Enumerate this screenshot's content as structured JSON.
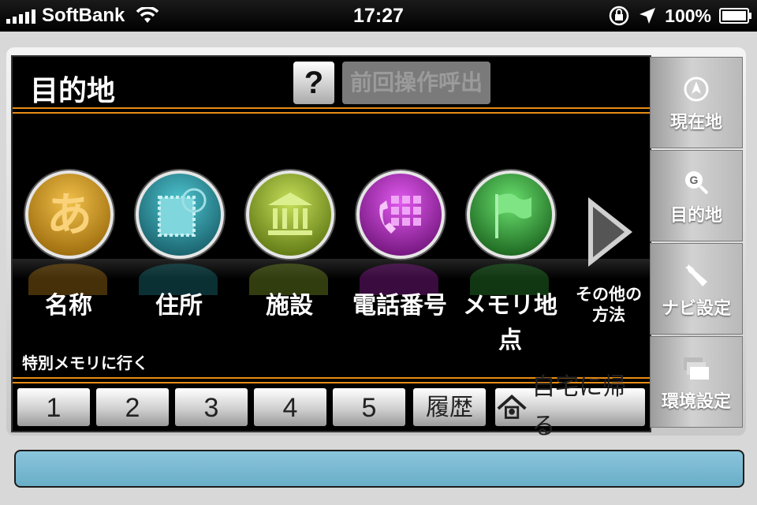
{
  "status_bar": {
    "carrier": "SoftBank",
    "time": "17:27",
    "battery": "100%"
  },
  "header": {
    "title": "目的地",
    "help_label": "?",
    "recall_label": "前回操作呼出"
  },
  "destinations": [
    {
      "label": "名称",
      "icon": "hiragana-a-icon",
      "glyph": "あ",
      "color": "#c98a1a"
    },
    {
      "label": "住所",
      "icon": "postal-stamp-icon",
      "glyph": "",
      "color": "#1e8a96"
    },
    {
      "label": "施設",
      "icon": "building-icon",
      "glyph": "",
      "color": "#8fae2a"
    },
    {
      "label": "電話番号",
      "icon": "phone-keypad-icon",
      "glyph": "",
      "color": "#a71fb3"
    },
    {
      "label": "メモリ地点",
      "icon": "flag-icon",
      "glyph": "",
      "color": "#2e9b33"
    }
  ],
  "other_methods": {
    "line1": "その他の",
    "line2": "方法"
  },
  "special_memory": {
    "label": "特別メモリに行く",
    "buttons": [
      "1",
      "2",
      "3",
      "4",
      "5"
    ],
    "history_label": "履歴",
    "home_label": "自宅に帰る"
  },
  "sidebar": [
    {
      "label": "現在地",
      "icon": "compass-icon"
    },
    {
      "label": "目的地",
      "icon": "search-g-icon"
    },
    {
      "label": "ナビ設定",
      "icon": "wrench-icon"
    },
    {
      "label": "環境設定",
      "icon": "layers-icon"
    }
  ],
  "colors": {
    "accent_orange": "#e98c15",
    "info_bar": "#7bb9d2"
  }
}
